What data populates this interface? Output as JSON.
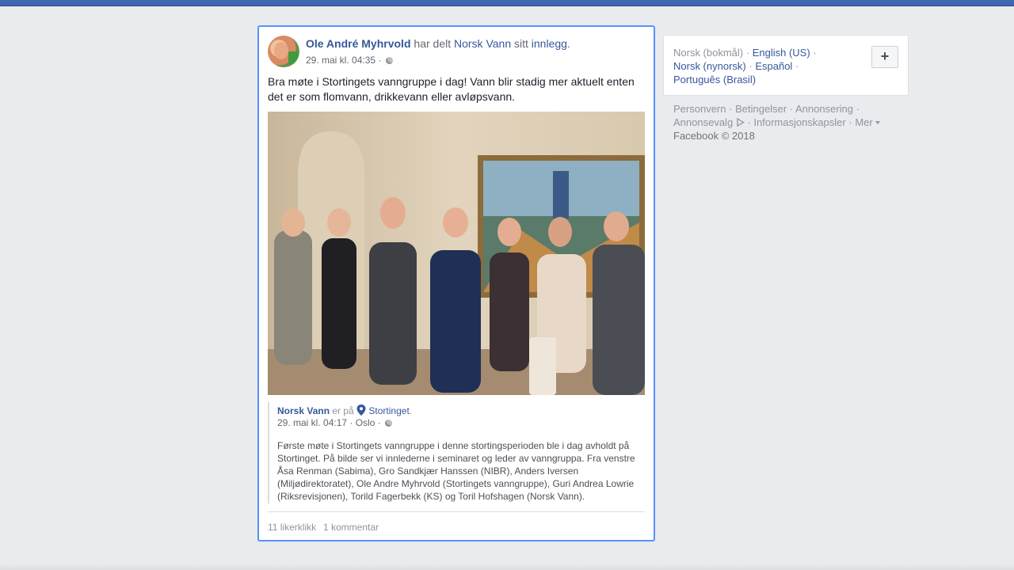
{
  "post": {
    "author": "Ole André Myhrvold",
    "shared_text": "har delt",
    "shared_page": "Norsk Vann",
    "possessive": "sitt",
    "shared_object": "innlegg",
    "period": ".",
    "timestamp": "29. mai kl. 04:35 ·",
    "body": "Bra møte i Stortingets vanngruppe i dag! Vann blir stadig mer aktuelt enten det er som flomvann, drikkevann eller avløpsvann.",
    "shared_post": {
      "page": "Norsk Vann",
      "is_at": "er på",
      "location": "Stortinget",
      "period": ".",
      "timestamp": "29. mai kl. 04:17 · Oslo ·",
      "text": "Første møte i Stortingets vanngruppe i denne stortingsperioden ble i dag avholdt på Stortinget. På bilde ser vi innlederne i seminaret og leder av vanngruppa. Fra venstre Åsa Renman (Sabima), Gro Sandkjær Hanssen (NIBR), Anders Iversen (Miljødirektoratet), Ole Andre Myhrvold (Stortingets vanngruppe), Guri Andrea Lowrie (Riksrevisjonen), Torild Fagerbekk (KS) og Toril Hofshagen (Norsk Vann)."
    },
    "likes": "11 likerklikk",
    "comments": "1 kommentar"
  },
  "sidebar": {
    "current_language": "Norsk (bokmål)",
    "sep": "·",
    "languages": [
      "English (US)",
      "Norsk (nynorsk)",
      "Español",
      "Português (Brasil)"
    ],
    "add_label": "+",
    "footer": {
      "privacy": "Personvern",
      "terms": "Betingelser",
      "ads": "Annonsering",
      "ad_choices": "Annonsevalg",
      "cookies": "Informasjonskapsler",
      "more": "Mer",
      "copyright": "Facebook © 2018"
    }
  },
  "colors": {
    "accent": "#4267b2",
    "link": "#365899",
    "focus_border": "#5890ff"
  },
  "icons": [
    "globe-icon",
    "location-pin-icon",
    "ad-choices-icon",
    "caret-down-icon",
    "plus-icon"
  ]
}
